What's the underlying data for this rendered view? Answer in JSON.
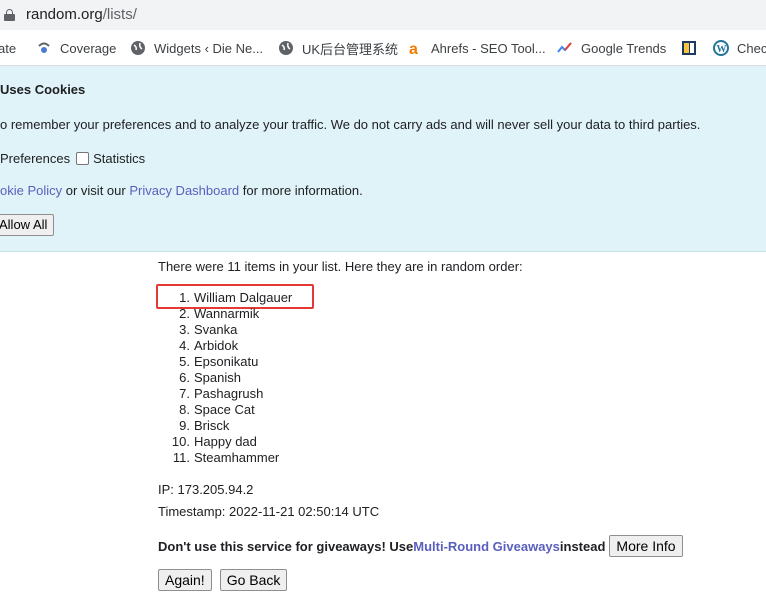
{
  "browser": {
    "url_host": "random.org",
    "url_path": "/lists/",
    "bookmarks": [
      {
        "label": "ate",
        "icon": "none"
      },
      {
        "label": "Coverage",
        "icon": "coverage-icon"
      },
      {
        "label": "Widgets ‹ Die Ne...",
        "icon": "globe-icon"
      },
      {
        "label": "UK后台管理系统",
        "icon": "globe-icon"
      },
      {
        "label": "Ahrefs - SEO Tool...",
        "icon": "ahrefs-icon"
      },
      {
        "label": "Google Trends",
        "icon": "trends-icon"
      },
      {
        "label": "",
        "icon": "bookmark-app-icon"
      },
      {
        "label": "Chec",
        "icon": "wordpress-icon"
      }
    ]
  },
  "cookie_banner": {
    "title": "Uses Cookies",
    "message": "o remember your preferences and to analyze your traffic. We do not carry ads and will never sell your data to third parties.",
    "option_preferences": "Preferences",
    "option_statistics": "Statistics",
    "policy_link": "okie Policy",
    "policy_mid": " or visit our ",
    "dashboard_link": "Privacy Dashboard",
    "policy_end": " for more information.",
    "allow_all": "Allow All"
  },
  "result": {
    "intro": "There were 11 items in your list. Here they are in random order:",
    "items": [
      {
        "num": "1.",
        "text": "William Dalgauer"
      },
      {
        "num": "2.",
        "text": "Wannarmik"
      },
      {
        "num": "3.",
        "text": "Svanka"
      },
      {
        "num": "4.",
        "text": "Arbidok"
      },
      {
        "num": "5.",
        "text": "Epsonikatu"
      },
      {
        "num": "6.",
        "text": "Spanish"
      },
      {
        "num": "7.",
        "text": "Pashagrush"
      },
      {
        "num": "8.",
        "text": "Space Cat"
      },
      {
        "num": "9.",
        "text": "Brisck"
      },
      {
        "num": "10.",
        "text": "Happy dad"
      },
      {
        "num": "11.",
        "text": "Steamhammer"
      }
    ],
    "ip": "IP: 173.205.94.2",
    "timestamp": "Timestamp: 2022-11-21 02:50:14 UTC",
    "warning_bold": "Don't use this service for giveaways! Use ",
    "warning_link": "Multi-Round Giveaways",
    "warning_end": " instead",
    "more_info": "More Info",
    "again": "Again!",
    "go_back": "Go Back"
  },
  "colors": {
    "cookie_bg": "#dff3f8",
    "link": "#5a5fbd",
    "highlight": "#e53935"
  }
}
